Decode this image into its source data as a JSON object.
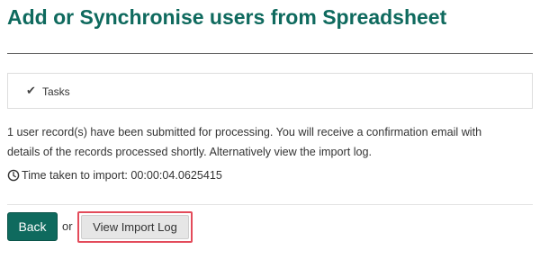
{
  "page": {
    "title": "Add or Synchronise users from Spreadsheet"
  },
  "tasks": {
    "icon": "check-icon",
    "label": "Tasks"
  },
  "message": {
    "line1": "1 user record(s) have been submitted for processing. You will receive a confirmation email with",
    "line2": "details of the records processed shortly. Alternatively view the import log."
  },
  "timing": {
    "icon": "clock-icon",
    "text": "Time taken to import: 00:00:04.0625415"
  },
  "actions": {
    "back_label": "Back",
    "separator": "or",
    "import_log_label": "View Import Log"
  },
  "colors": {
    "brand": "#0f6a5e",
    "highlight": "#e34b5a"
  }
}
